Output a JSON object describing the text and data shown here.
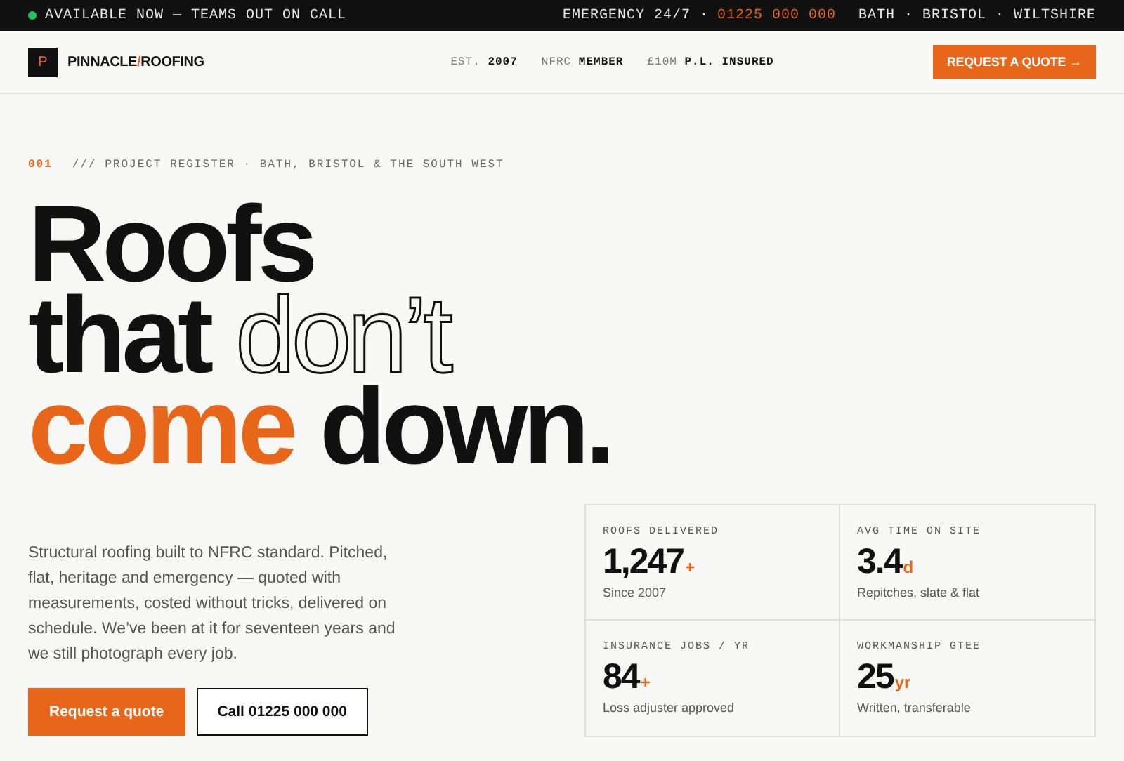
{
  "top_bar": {
    "status": "AVAILABLE NOW — TEAMS OUT ON CALL",
    "emergency": "EMERGENCY 24/7 ·",
    "phone": "01225 000 000",
    "areas": "BATH · BRISTOL · WILTSHIRE"
  },
  "header": {
    "logo_mark": "P",
    "brand": [
      {
        "text": "PINNACLE",
        "kind": "plain"
      },
      {
        "text": "/",
        "kind": "accent"
      },
      {
        "text": "ROOFING",
        "kind": "plain"
      }
    ],
    "credentials": [
      "EST. **2007**",
      "NFRC **MEMBER**",
      "£10M **P.L. INSURED**"
    ],
    "cta": "REQUEST A QUOTE →"
  },
  "hero": {
    "index": "001",
    "eyebrow": "/// PROJECT REGISTER · BATH, BRISTOL & THE SOUTH WEST",
    "headline": [
      [
        {
          "text": "Roofs",
          "kind": "plain"
        }
      ],
      [
        {
          "text": "that",
          "kind": "plain"
        },
        {
          "text": "don’t",
          "kind": "outline"
        }
      ],
      [
        {
          "text": "come",
          "kind": "accent"
        },
        {
          "text": "down.",
          "kind": "plain"
        }
      ]
    ],
    "intro": "Structural roofing built to NFRC standard. Pitched, flat, heritage and emergency — quoted with measurements, costed without tricks, delivered on schedule. We’ve been at it for seventeen years and we still photograph every job.",
    "buttons": [
      {
        "label": "Request a quote",
        "kind": "primary"
      },
      {
        "label": "Call 01225 000 000",
        "kind": "outline"
      }
    ]
  },
  "stats": [
    {
      "label": "ROOFS DELIVERED",
      "value": "1,247",
      "unit": "+",
      "note": "Since 2007"
    },
    {
      "label": "AVG TIME ON SITE",
      "value": "3.4",
      "unit": "d",
      "note": "Repitches, slate & flat"
    },
    {
      "label": "INSURANCE JOBS / YR",
      "value": "84",
      "unit": "+",
      "note": "Loss adjuster approved"
    },
    {
      "label": "WORKMANSHIP GTEE",
      "value": "25",
      "unit": "yr",
      "note": "Written, transferable"
    }
  ]
}
